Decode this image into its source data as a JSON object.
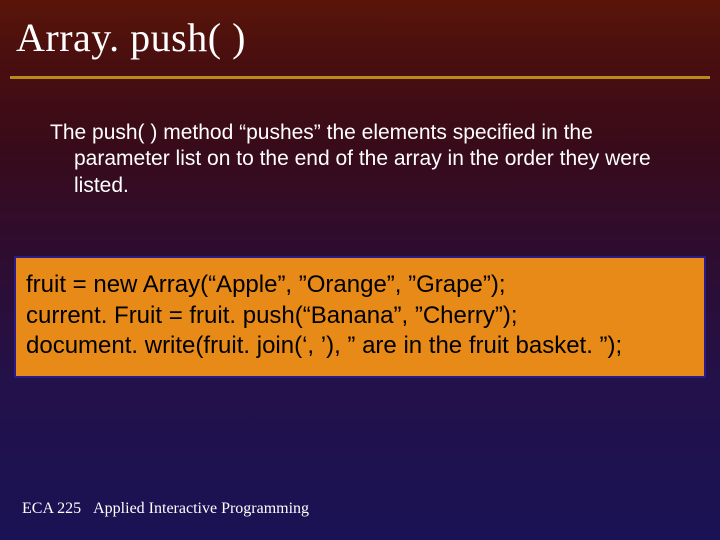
{
  "title": "Array. push( )",
  "body": "The push( ) method “pushes” the elements specified in the parameter list on to the end of the array in the order they were listed.",
  "code": {
    "line1": "fruit = new Array(“Apple”, ”Orange”, ”Grape”);",
    "line2": "current. Fruit = fruit. push(“Banana”, ”Cherry”);",
    "line3": "document. write(fruit. join(‘, ’), ” are in the fruit basket. ”);"
  },
  "footer": "ECA 225   Applied Interactive Programming"
}
